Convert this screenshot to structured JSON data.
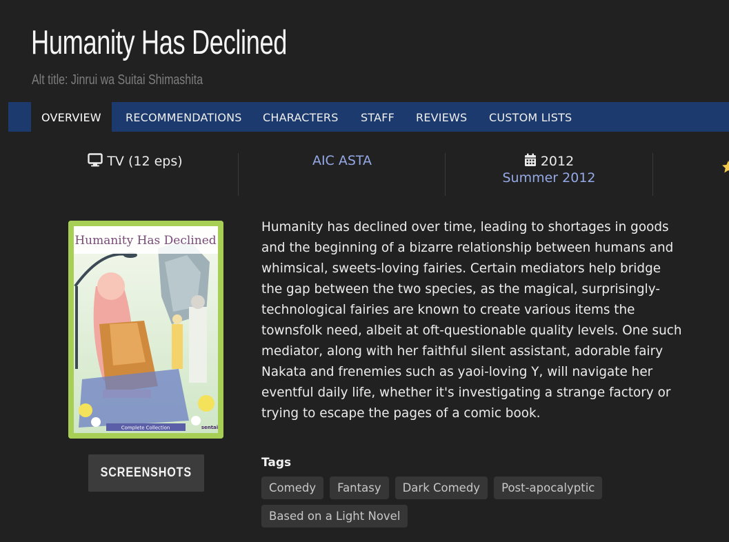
{
  "page": {
    "title": "Humanity Has Declined",
    "alt_title": "Alt title: Jinrui wa Suitai Shimashita"
  },
  "nav": {
    "tabs": [
      {
        "label": "OVERVIEW",
        "active": true
      },
      {
        "label": "RECOMMENDATIONS",
        "active": false
      },
      {
        "label": "CHARACTERS",
        "active": false
      },
      {
        "label": "STAFF",
        "active": false
      },
      {
        "label": "REVIEWS",
        "active": false
      },
      {
        "label": "CUSTOM LISTS",
        "active": false
      }
    ]
  },
  "info": {
    "format": "TV (12 eps)",
    "format_icon": "monitor-icon",
    "studio": "AIC ASTA",
    "year": "2012",
    "year_icon": "calendar-icon",
    "season": "Summer 2012",
    "rating_icon": "star-icon"
  },
  "cover": {
    "logo_text": "Humanity Has Declined",
    "caption": "Complete Collection",
    "publisher": "sentai"
  },
  "screenshots_label": "SCREENSHOTS",
  "synopsis": "Humanity has declined over time, leading to shortages in goods and the beginning of a bizarre relationship between humans and whimsical, sweets-loving fairies. Certain mediators help bridge the gap between the two species, as the magical, surprisingly-technological fairies are known to create various items the townsfolk need, albeit at oft-questionable quality levels. One such mediator, along with her faithful silent assistant, adorable fairy Nakata and frenemies such as yaoi-loving Y, will navigate her eventful daily life, whether it's investigating a strange factory or trying to escape the pages of a comic book.",
  "tags": {
    "label": "Tags",
    "items": [
      "Comedy",
      "Fantasy",
      "Dark Comedy",
      "Post-apocalyptic",
      "Based on a Light Novel"
    ]
  },
  "colors": {
    "background": "#212121",
    "nav": "#1c3a6d",
    "link": "#95a9e6",
    "tag_bg": "#363636"
  }
}
